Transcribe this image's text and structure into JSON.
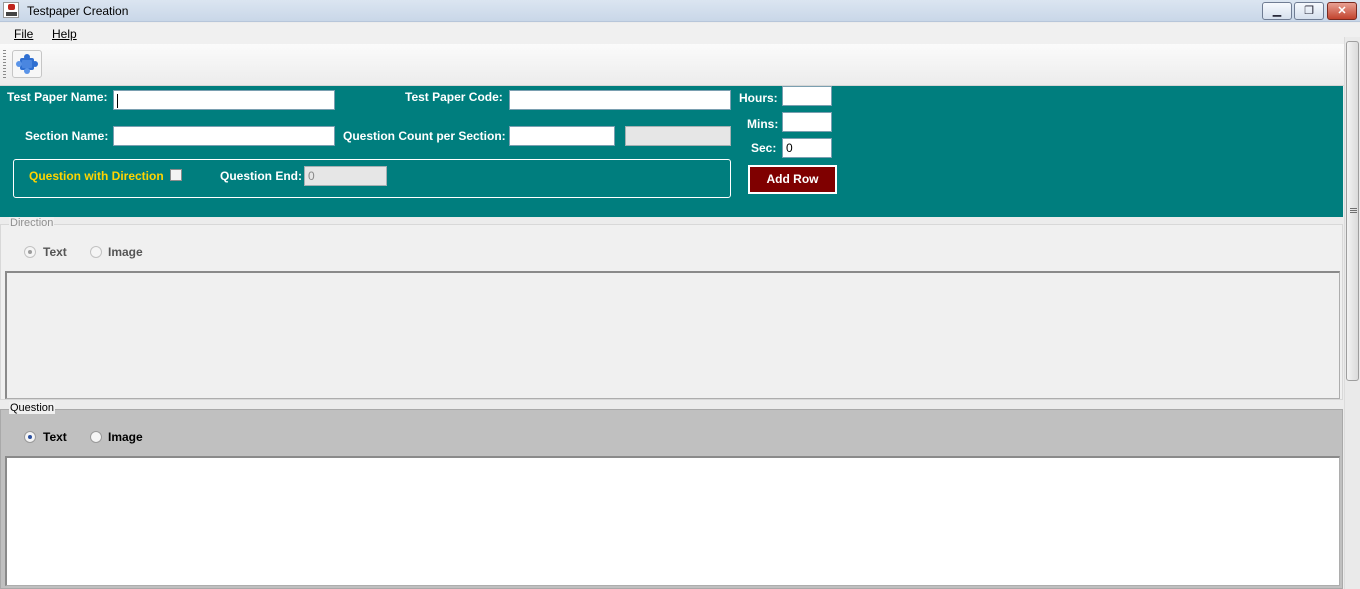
{
  "window": {
    "title": "Testpaper Creation"
  },
  "menu": {
    "file": "File",
    "help": "Help"
  },
  "toolbar": {
    "tool_icon": "puzzle-icon"
  },
  "form": {
    "test_paper_name_label": "Test Paper Name:",
    "test_paper_name_value": "",
    "test_paper_code_label": "Test Paper Code:",
    "test_paper_code_value": "",
    "section_name_label": "Section Name:",
    "section_name_value": "",
    "question_count_label": "Question Count per Section:",
    "question_count_value": "",
    "question_count_extra_value": "",
    "hours_label": "Hours:",
    "hours_value": "",
    "mins_label": "Mins:",
    "mins_value": "",
    "sec_label": "Sec:",
    "sec_value": "0",
    "question_with_direction_label": "Question with Direction",
    "question_with_direction_checked": false,
    "question_end_label": "Question End:",
    "question_end_value": "0",
    "add_row_label": "Add Row"
  },
  "direction": {
    "legend": "Direction",
    "text_option": "Text",
    "image_option": "Image",
    "selected": "Text",
    "enabled": false
  },
  "question": {
    "legend": "Question",
    "text_option": "Text",
    "image_option": "Image",
    "selected": "Text",
    "enabled": true
  },
  "colors": {
    "panel": "#007e7e",
    "accent_label": "#ffd400",
    "add_row_button": "#7f0000"
  }
}
